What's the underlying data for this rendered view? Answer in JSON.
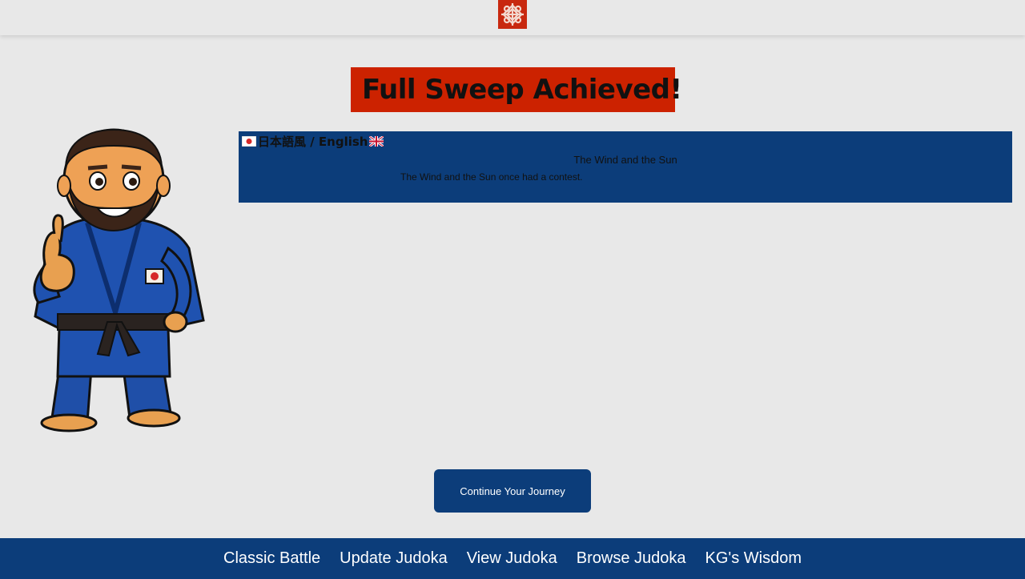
{
  "header": {
    "logo_icon": "knot-logo-icon",
    "logo_color": "#c8280f"
  },
  "banner": {
    "icon": "trophy-icon",
    "title": "Full Sweep Achieved!",
    "background": "#cc2200"
  },
  "mascot": {
    "icon": "judoka-mascot-thumbs-up"
  },
  "story": {
    "language_toggle": {
      "flag_left": "japan-flag-icon",
      "label": "日本語風 / English",
      "flag_right": "uk-flag-icon"
    },
    "title": "The Wind and the Sun",
    "text": "The Wind and the Sun once had a contest.",
    "background": "#0c3d7a"
  },
  "actions": {
    "continue_label": "Continue Your Journey"
  },
  "bottom_nav": {
    "items": [
      {
        "label": "Classic Battle"
      },
      {
        "label": "Update Judoka"
      },
      {
        "label": "View Judoka"
      },
      {
        "label": "Browse Judoka"
      },
      {
        "label": "KG's Wisdom"
      }
    ],
    "background": "#0c3d7a"
  }
}
